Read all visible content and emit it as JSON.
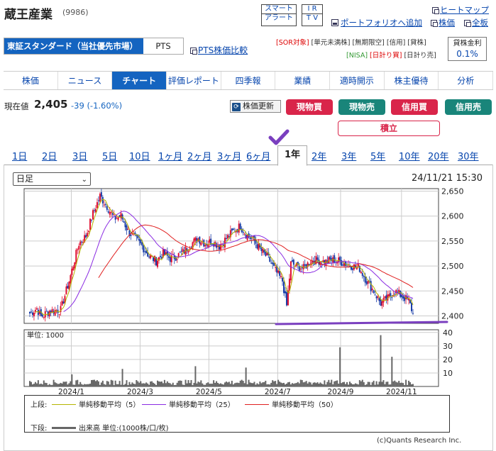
{
  "company": {
    "name": "蔵王産業",
    "code": "(9986)"
  },
  "header_buttons": {
    "smart_alert": [
      "スマート",
      "アラート"
    ],
    "ir_tv": [
      "I R",
      "T V"
    ],
    "add_portfolio": "ポートフォリオへ追加"
  },
  "right_links": {
    "heatmap": "ヒートマップ",
    "stock_price": "株価",
    "board": "全板"
  },
  "market": {
    "selected": "東証スタンダード（当社優先市場）",
    "pts": "PTS",
    "pts_compare": "PTS株価比較"
  },
  "badges": {
    "row1": [
      "[SOR対象]",
      "[単元未満株]",
      "[無期限空]",
      "[信用]",
      "[貸株]"
    ],
    "row2": [
      "[NISA]",
      "[日計り買]",
      "[日計り売]"
    ]
  },
  "lending_rate": {
    "label": "貸株金利",
    "value": "0.1%"
  },
  "nav_tabs": [
    "株価",
    "ニュース",
    "チャート",
    "評価レポート",
    "四季報",
    "業績",
    "適時開示",
    "株主優待",
    "分析"
  ],
  "nav_active": "チャート",
  "price": {
    "label": "現在値",
    "value": "2,405",
    "change": "-39 (-1.60%)"
  },
  "actions": {
    "refresh": "株価更新",
    "spot_buy": "現物買",
    "spot_sell": "現物売",
    "margin_buy": "信用買",
    "margin_sell": "信用売",
    "tsumitate": "積立"
  },
  "periods": [
    "1日",
    "2日",
    "3日",
    "5日",
    "10日",
    "1ヶ月",
    "2ヶ月",
    "3ヶ月",
    "6ヶ月",
    "1年",
    "2年",
    "3年",
    "5年",
    "10年",
    "20年",
    "30年"
  ],
  "active_period": "1年",
  "chart_controls": {
    "interval": "日足",
    "datetime": "24/11/21 15:30"
  },
  "chart_data": {
    "type": "candlestick",
    "title": "",
    "price_axis": {
      "ticks": [
        "2,650",
        "2,600",
        "2,550",
        "2,500",
        "2,450",
        "2,400"
      ],
      "range": [
        2385,
        2655
      ]
    },
    "volume_axis": {
      "unit_label": "単位: 1000",
      "ticks": [
        "40",
        "30",
        "20",
        "10"
      ],
      "range": [
        0,
        42
      ]
    },
    "x_ticks": [
      "2024/1",
      "2024/3",
      "2024/5",
      "2024/7",
      "2024/9",
      "2024/11"
    ],
    "price_anchors": [
      [
        0,
        2405
      ],
      [
        5,
        2415
      ],
      [
        8,
        2398
      ],
      [
        14,
        2410
      ],
      [
        22,
        2412
      ],
      [
        28,
        2470
      ],
      [
        35,
        2545
      ],
      [
        40,
        2560
      ],
      [
        45,
        2605
      ],
      [
        50,
        2640
      ],
      [
        55,
        2620
      ],
      [
        60,
        2595
      ],
      [
        65,
        2600
      ],
      [
        70,
        2570
      ],
      [
        75,
        2555
      ],
      [
        80,
        2540
      ],
      [
        85,
        2520
      ],
      [
        90,
        2510
      ],
      [
        95,
        2525
      ],
      [
        100,
        2515
      ],
      [
        105,
        2520
      ],
      [
        110,
        2530
      ],
      [
        115,
        2545
      ],
      [
        120,
        2555
      ],
      [
        125,
        2545
      ],
      [
        130,
        2550
      ],
      [
        135,
        2540
      ],
      [
        140,
        2555
      ],
      [
        145,
        2570
      ],
      [
        150,
        2580
      ],
      [
        155,
        2560
      ],
      [
        160,
        2550
      ],
      [
        165,
        2530
      ],
      [
        170,
        2515
      ],
      [
        175,
        2490
      ],
      [
        180,
        2470
      ],
      [
        183,
        2420
      ],
      [
        186,
        2505
      ],
      [
        190,
        2500
      ],
      [
        195,
        2495
      ],
      [
        200,
        2510
      ],
      [
        205,
        2512
      ],
      [
        210,
        2508
      ],
      [
        215,
        2512
      ],
      [
        220,
        2510
      ],
      [
        225,
        2505
      ],
      [
        230,
        2500
      ],
      [
        235,
        2495
      ],
      [
        240,
        2470
      ],
      [
        245,
        2450
      ],
      [
        250,
        2425
      ],
      [
        255,
        2435
      ],
      [
        260,
        2450
      ],
      [
        265,
        2440
      ],
      [
        270,
        2430
      ],
      [
        273,
        2405
      ]
    ],
    "volume_spikes": [
      [
        250,
        38
      ],
      [
        221,
        29
      ],
      [
        258,
        22
      ],
      [
        118,
        15
      ],
      [
        154,
        14
      ],
      [
        66,
        13
      ],
      [
        30,
        9
      ]
    ],
    "support_line": 2395,
    "legend": {
      "upper_label": "上段:",
      "lower_label": "下段:",
      "series": [
        {
          "name": "単純移動平均（5）",
          "period": 5,
          "color": "#b5b500"
        },
        {
          "name": "単純移動平均（25）",
          "period": 25,
          "color": "#8a2be2"
        },
        {
          "name": "単純移動平均（50）",
          "period": 50,
          "color": "#e02020"
        }
      ],
      "volume": {
        "name": "出来高 単位:(1000株/口/枚)",
        "color": "#666666"
      }
    },
    "up_color": "#e01030",
    "down_color": "#1a3ea8"
  },
  "copyright": "(c)Quants Research Inc."
}
